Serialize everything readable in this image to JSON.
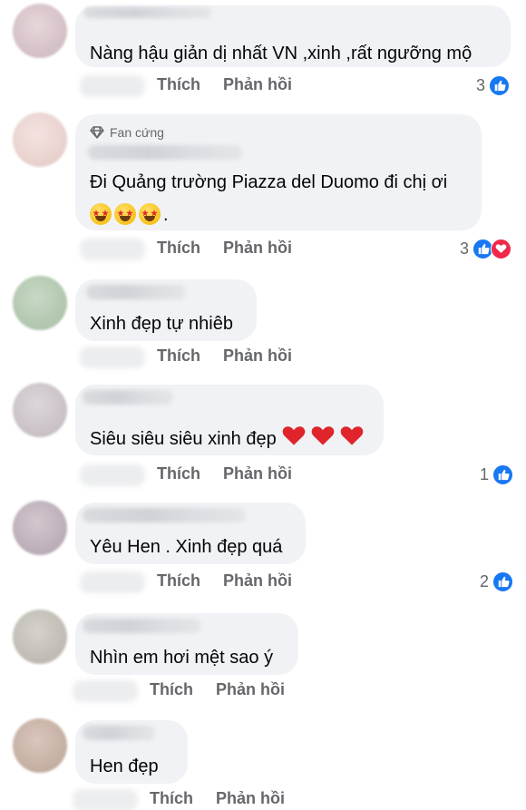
{
  "colors": {
    "like_blue": "#1877f2",
    "love_red": "#f0284a",
    "bubble": "#f0f2f5",
    "meta_gray": "#65676b"
  },
  "actions": {
    "like": "Thích",
    "reply": "Phản hồi"
  },
  "comments": [
    {
      "text": "Nàng hậu giản dị nhất VN ,xinh ,rất ngưỡng mộ",
      "reactions": "3",
      "reaction_icons": [
        "like-icon"
      ]
    },
    {
      "badge": "Fan cứng",
      "badge_icon": "diamond-icon",
      "text": "Đi Quảng trường Piazza del Duomo đi chị ơi",
      "text2": ".",
      "emoji": [
        "star-struck-emoji",
        "star-struck-emoji",
        "star-struck-emoji"
      ],
      "reactions": "3",
      "reaction_icons": [
        "like-icon",
        "love-icon"
      ]
    },
    {
      "text": "Xinh đẹp tự nhiêb"
    },
    {
      "text": "Siêu siêu siêu xinh đẹp",
      "emoji": [
        "red-heart-emoji",
        "red-heart-emoji",
        "red-heart-emoji"
      ],
      "reactions": "1",
      "reaction_icons": [
        "like-icon"
      ]
    },
    {
      "text": "Yêu Hen . Xinh đẹp quá",
      "reactions": "2",
      "reaction_icons": [
        "like-icon"
      ]
    },
    {
      "text": "Nhìn em hơi mệt sao ý"
    },
    {
      "text": "Hen đẹp"
    }
  ]
}
